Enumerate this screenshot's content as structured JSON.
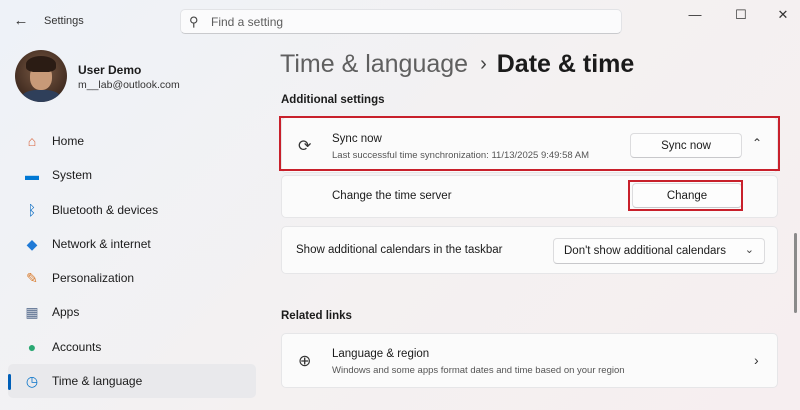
{
  "titlebar": {
    "app_title": "Settings",
    "back_icon": "back-arrow-icon",
    "search_placeholder": "Find a setting",
    "controls": {
      "minimize": "—",
      "maximize": "☐",
      "close": "✕"
    }
  },
  "user": {
    "name": "User Demo",
    "email": "m__lab@outlook.com"
  },
  "sidebar": {
    "items": [
      {
        "label": "Home",
        "icon": "home-icon",
        "glyph": "⌂",
        "color": "#d9633a",
        "active": false
      },
      {
        "label": "System",
        "icon": "system-icon",
        "glyph": "▬",
        "color": "#0078d4",
        "active": false
      },
      {
        "label": "Bluetooth & devices",
        "icon": "bluetooth-icon",
        "glyph": "ᛒ",
        "color": "#0067c0",
        "active": false
      },
      {
        "label": "Network & internet",
        "icon": "wifi-icon",
        "glyph": "◆",
        "color": "#1f7ad6",
        "active": false
      },
      {
        "label": "Personalization",
        "icon": "brush-icon",
        "glyph": "✎",
        "color": "#d87a2a",
        "active": false
      },
      {
        "label": "Apps",
        "icon": "apps-icon",
        "glyph": "▦",
        "color": "#5a6f8f",
        "active": false
      },
      {
        "label": "Accounts",
        "icon": "accounts-icon",
        "glyph": "●",
        "color": "#2aa872",
        "active": false
      },
      {
        "label": "Time & language",
        "icon": "time-language-icon",
        "glyph": "◷",
        "color": "#0a74c9",
        "active": true
      }
    ]
  },
  "breadcrumb": {
    "parent": "Time & language",
    "separator": "›",
    "current": "Date & time"
  },
  "additional_settings": {
    "title": "Additional settings",
    "sync": {
      "title": "Sync now",
      "subtitle": "Last successful time synchronization: 11/13/2025 9:49:58 AM",
      "button": "Sync now",
      "icon": "sync-clock-icon"
    },
    "time_server": {
      "title": "Change the time server",
      "button": "Change"
    },
    "calendars": {
      "title": "Show additional calendars in the taskbar",
      "selected": "Don't show additional calendars"
    }
  },
  "related_links": {
    "title": "Related links",
    "language_region": {
      "title": "Language & region",
      "subtitle": "Windows and some apps format dates and time based on your region",
      "icon": "globe-language-icon"
    }
  },
  "colors": {
    "highlight": "#c8202b",
    "accent": "#005fb8"
  }
}
